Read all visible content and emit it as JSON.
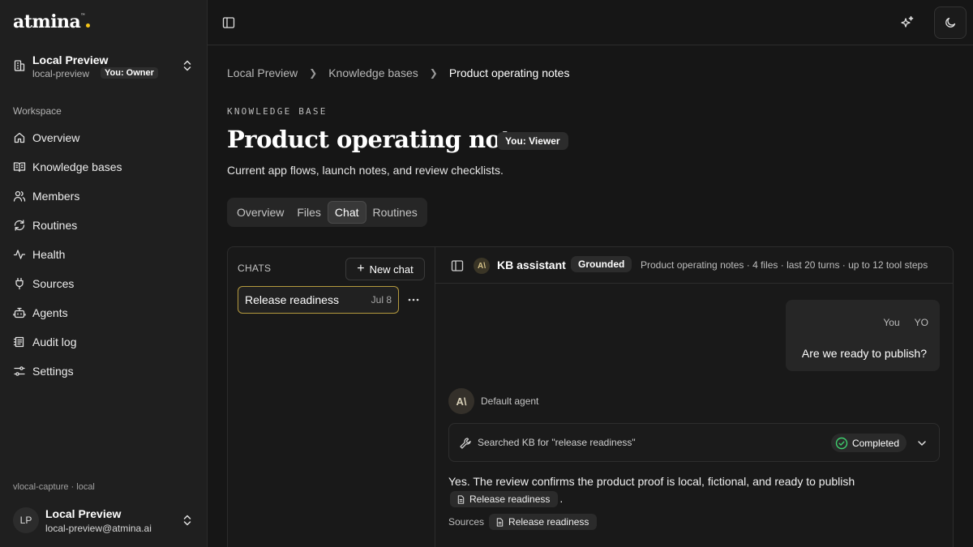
{
  "brand": {
    "name": "atmina",
    "tm": "™",
    "accent": "#f5c518"
  },
  "org": {
    "name": "Local Preview",
    "slug": "local-preview",
    "role": "You: Owner"
  },
  "sidebar": {
    "section": "Workspace",
    "items": [
      {
        "label": "Overview",
        "icon": "home-icon"
      },
      {
        "label": "Knowledge bases",
        "icon": "book-icon"
      },
      {
        "label": "Members",
        "icon": "users-icon"
      },
      {
        "label": "Routines",
        "icon": "refresh-icon"
      },
      {
        "label": "Health",
        "icon": "activity-icon"
      },
      {
        "label": "Sources",
        "icon": "plug-icon"
      },
      {
        "label": "Agents",
        "icon": "bot-icon"
      },
      {
        "label": "Audit log",
        "icon": "log-icon"
      },
      {
        "label": "Settings",
        "icon": "sliders-icon"
      }
    ],
    "env": "vlocal-capture · local"
  },
  "user": {
    "initials": "LP",
    "name": "Local Preview",
    "email": "local-preview@atmina.ai"
  },
  "breadcrumb": [
    "Local Preview",
    "Knowledge bases",
    "Product operating notes"
  ],
  "page": {
    "eyebrow": "KNOWLEDGE BASE",
    "title": "Product operating notes",
    "role": "You: Viewer",
    "description": "Current app flows, launch notes, and review checklists."
  },
  "tabs": [
    {
      "label": "Overview",
      "active": false
    },
    {
      "label": "Files",
      "active": false
    },
    {
      "label": "Chat",
      "active": true
    },
    {
      "label": "Routines",
      "active": false
    }
  ],
  "chats": {
    "label": "CHATS",
    "new_label": "New chat",
    "items": [
      {
        "title": "Release readiness",
        "date": "Jul 8"
      }
    ]
  },
  "conversation": {
    "assistant_name": "KB assistant",
    "grounded": "Grounded",
    "meta": "Product operating notes · 4 files · last 20 turns · up to 12 tool steps",
    "user_label": "You",
    "user_initials": "YO",
    "user_message": "Are we ready to publish?",
    "agent_name": "Default agent",
    "tool_call": "Searched KB for \"release readiness\"",
    "tool_status": "Completed",
    "answer": "Yes. The review confirms the product proof is local, fictional, and ready to publish",
    "answer_citation": "Release readiness",
    "answer_end": ".",
    "sources_label": "Sources",
    "source": "Release readiness"
  }
}
